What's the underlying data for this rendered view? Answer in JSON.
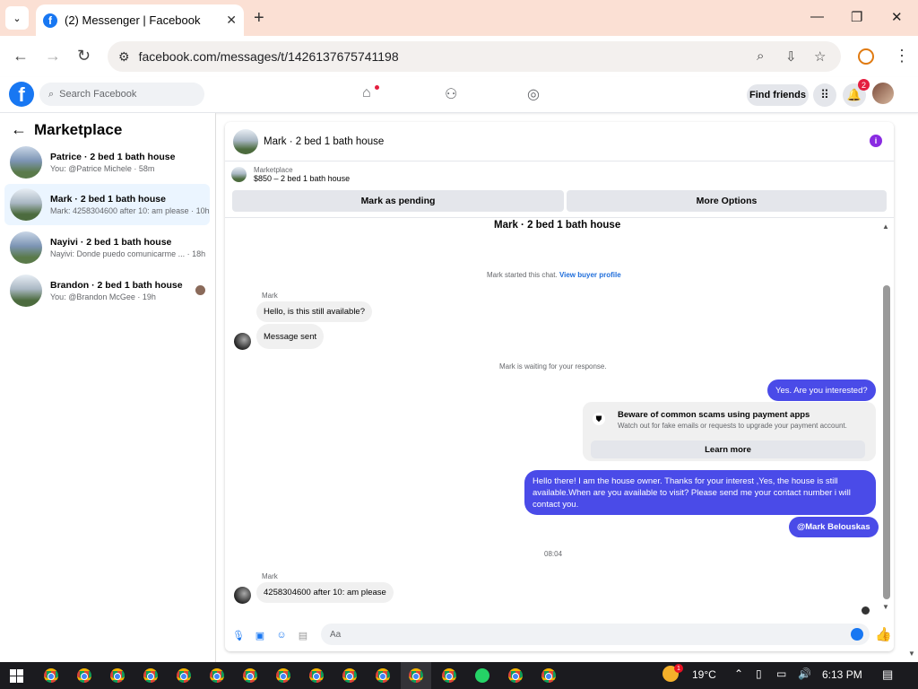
{
  "browser": {
    "tab_title": "(2) Messenger | Facebook",
    "url": "facebook.com/messages/t/1426137675741198"
  },
  "fb": {
    "search_placeholder": "Search Facebook",
    "find_friends": "Find friends",
    "notif_count": "2"
  },
  "sidebar": {
    "title": "Marketplace",
    "conversations": [
      {
        "title": "Patrice · 2 bed 1 bath house",
        "preview": "You: @Patrice Michele · 58m"
      },
      {
        "title": "Mark · 2 bed 1 bath house",
        "preview": "Mark: 4258304600 after 10: am please · 10h"
      },
      {
        "title": "Nayivi · 2 bed 1 bath house",
        "preview": "Nayivi: Donde puedo comunicarme ... · 18h"
      },
      {
        "title": "Brandon · 2 bed 1 bath house",
        "preview": "You: @Brandon McGee · 19h"
      }
    ]
  },
  "chat": {
    "header_name": "Mark · 2 bed 1 bath house",
    "marketplace_label": "Marketplace",
    "listing": "$850 – 2 bed 1 bath house",
    "mark_pending": "Mark as pending",
    "more_options": "More Options",
    "thread_title": "Mark · 2 bed 1 bath house",
    "started": "Mark started this chat.",
    "view_profile": "View buyer profile",
    "sender1": "Mark",
    "msg1": "Hello, is this still available?",
    "msg2": "Message sent",
    "waiting": "Mark is waiting for your response.",
    "out1": "Yes. Are you interested?",
    "scam_title": "Beware of common scams using payment apps",
    "scam_sub": "Watch out for fake emails or requests to upgrade your payment account.",
    "learn_more": "Learn more",
    "out2": "Hello there! I am the house owner. Thanks for your interest ,Yes, the house is still available.When are you available to visit? Please send me your contact number i will contact you.",
    "out3": "@Mark Belouskas",
    "time": "08:04",
    "sender2": "Mark",
    "msg3": "4258304600 after 10: am please",
    "composer_placeholder": "Aa"
  },
  "taskbar": {
    "temperature": "19°C",
    "clock": "6:13 PM",
    "weather_badge": "1"
  }
}
